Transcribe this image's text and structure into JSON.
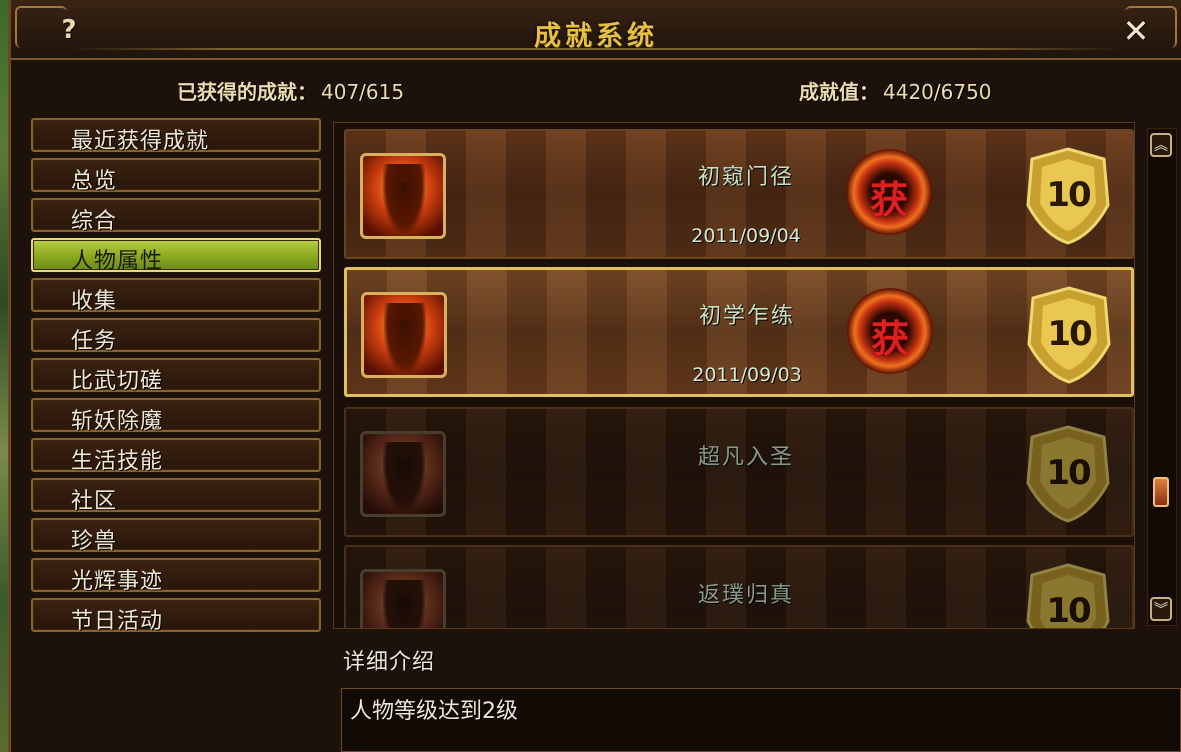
{
  "window": {
    "title": "成就系统",
    "help_label": "?",
    "close_label": "✕"
  },
  "stats": {
    "earned_label": "已获得的成就：",
    "earned_value": "407/615",
    "points_label": "成就值：",
    "points_value": "4420/6750"
  },
  "categories": [
    {
      "label": "最近获得成就"
    },
    {
      "label": "总览"
    },
    {
      "label": "综合"
    },
    {
      "label": "人物属性",
      "active": true
    },
    {
      "label": "收集"
    },
    {
      "label": "任务"
    },
    {
      "label": "比武切磋"
    },
    {
      "label": "斩妖除魔"
    },
    {
      "label": "生活技能"
    },
    {
      "label": "社区"
    },
    {
      "label": "珍兽"
    },
    {
      "label": "光辉事迹"
    },
    {
      "label": "节日活动"
    }
  ],
  "achievements": [
    {
      "name": "初窥门径",
      "date": "2011/09/04",
      "seal": "获",
      "points": "10",
      "state": "earned"
    },
    {
      "name": "初学乍练",
      "date": "2011/09/03",
      "seal": "获",
      "points": "10",
      "state": "selected"
    },
    {
      "name": "超凡入圣",
      "date": "",
      "seal": "",
      "points": "10",
      "state": "locked"
    },
    {
      "name": "返璞归真",
      "date": "",
      "seal": "",
      "points": "10",
      "state": "locked"
    }
  ],
  "scrollbar": {
    "up_icon": "double-chevron-up-icon",
    "down_icon": "double-chevron-down-icon",
    "position_fraction": 0.73
  },
  "detail": {
    "label": "详细介绍",
    "text": "人物等级达到2级"
  },
  "colors": {
    "title": "#e8c040",
    "active_category": "#a8c030",
    "selected_border": "#e0c060"
  }
}
